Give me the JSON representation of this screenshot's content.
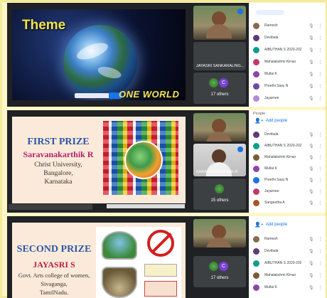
{
  "panels": [
    {
      "slide": {
        "title": "Theme",
        "subtitle": "ONE WORLD"
      },
      "tiles": {
        "presenter_name": "JAYASRI SANKARALING...",
        "others_count": "17 others",
        "avatar_letter": "C"
      },
      "participants": {
        "people": [
          {
            "name": "Ramesh",
            "color": "#8a6a4a"
          },
          {
            "name": "Devibala",
            "color": "#5f3a7a"
          },
          {
            "name": "AIBUTHAN S 2020-2024",
            "color": "#0f9d8a"
          },
          {
            "name": "Mahalakshmi Kirrao",
            "color": "#c0396b"
          },
          {
            "name": "Mullai K",
            "color": "#8e44ad"
          },
          {
            "name": "Preethi Sasy N",
            "color": "#6d4c9b"
          },
          {
            "name": "Jayarnee",
            "color": "#b38ad6"
          }
        ]
      }
    },
    {
      "section_label": "People",
      "add_people": "Add people",
      "slide": {
        "title": "FIRST PRIZE",
        "winner": "Saravanakarthik R",
        "lines": [
          "Christ University,",
          "Bangalore,",
          "Karnataka"
        ]
      },
      "tiles": {
        "presenter_name": "SARAVANAKARTHIK R",
        "others_count": "15 others"
      },
      "participants": {
        "people": [
          {
            "name": "Devibala",
            "color": "#5f3a7a"
          },
          {
            "name": "AIBUTHAN S 2020-2024",
            "color": "#0f9d8a"
          },
          {
            "name": "Mahalakshmi Kirrao",
            "color": "#7a5a3a"
          },
          {
            "name": "Mullai K",
            "color": "#8e44ad"
          },
          {
            "name": "Preethi Sasy N",
            "color": "#1a73e8"
          },
          {
            "name": "Jayarnee",
            "color": "#c0396b"
          },
          {
            "name": "Sangeetha A",
            "color": "#a05a2a"
          }
        ]
      }
    },
    {
      "add_people": "Add people",
      "slide": {
        "title": "SECOND PRIZE",
        "winner": "JAYASRI S",
        "lines": [
          "Govt. Arts college of women,",
          "Sivaganga,",
          "TamilNadu."
        ]
      },
      "tiles": {
        "others_count": "17 others",
        "avatar_letter": "C"
      },
      "participants": {
        "people": [
          {
            "name": "Ramesh",
            "color": "#8a6a4a"
          },
          {
            "name": "Devibala",
            "color": "#5f3a7a"
          },
          {
            "name": "AIBUTHAN S 2020-2024",
            "color": "#0f9d8a"
          },
          {
            "name": "Mahalakshmi Kirrao",
            "color": "#7a5a3a"
          },
          {
            "name": "Mullai K",
            "color": "#8e44ad"
          }
        ]
      }
    }
  ],
  "icons": {
    "mic": "microphone-icon",
    "more": "more-vertical-icon",
    "add_person": "add-person-icon"
  },
  "colors": {
    "meet_dark": "#202124",
    "accent_blue": "#1a73e8",
    "prize_title": "#2d56a8",
    "prize_name": "#b21f6a",
    "theme_yellow": "#f4e54a",
    "page_bg": "#fdf6c8"
  }
}
